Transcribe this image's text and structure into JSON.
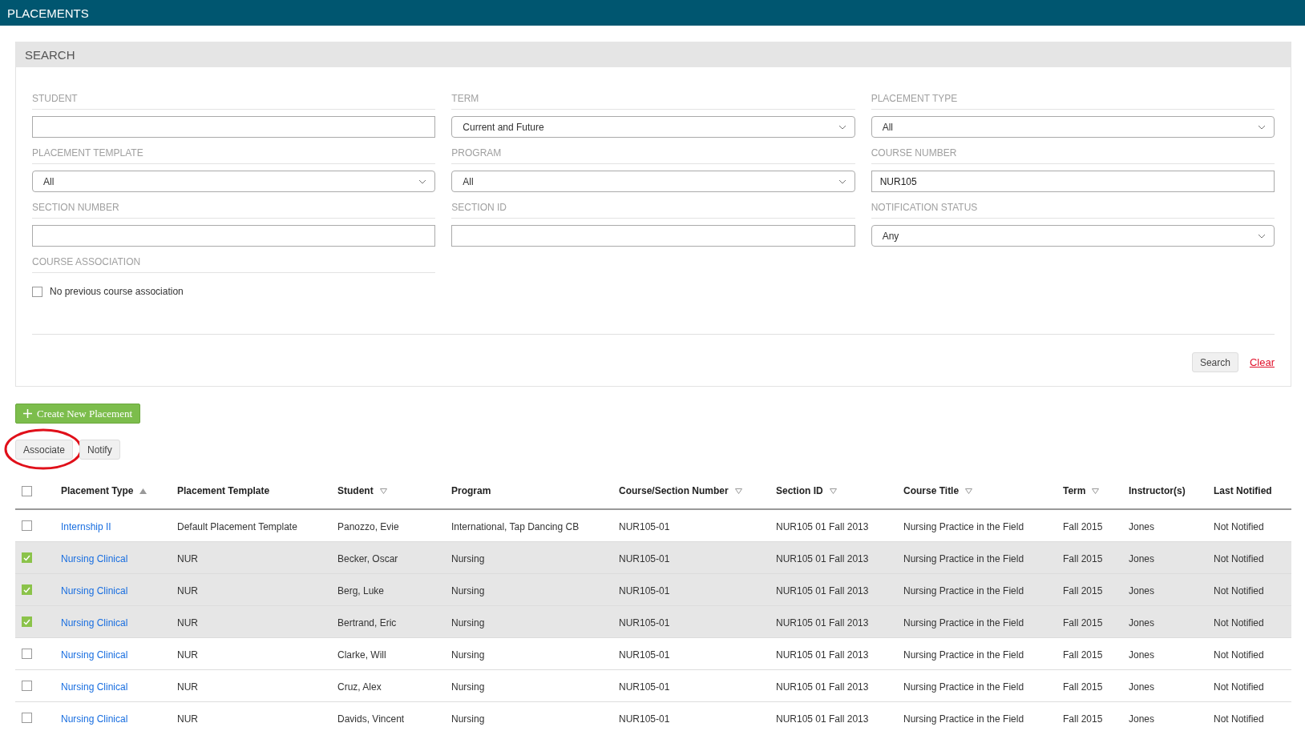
{
  "header": {
    "title": "PLACEMENTS"
  },
  "search": {
    "title": "SEARCH",
    "fields": [
      {
        "label": "STUDENT",
        "kind": "text"
      },
      {
        "label": "TERM",
        "kind": "select",
        "value": "Current and Future"
      },
      {
        "label": "PLACEMENT TYPE",
        "kind": "select",
        "value": "All"
      },
      {
        "label": "PLACEMENT TEMPLATE",
        "kind": "select",
        "value": "All"
      },
      {
        "label": "PROGRAM",
        "kind": "select",
        "value": "All"
      },
      {
        "label": "COURSE NUMBER",
        "kind": "text",
        "value": "NUR105"
      },
      {
        "label": "SECTION NUMBER",
        "kind": "text"
      },
      {
        "label": "SECTION ID",
        "kind": "text"
      },
      {
        "label": "NOTIFICATION STATUS",
        "kind": "select",
        "value": "Any"
      }
    ],
    "association": {
      "label": "COURSE ASSOCIATION",
      "option": "No previous course association",
      "checked": false
    },
    "buttons": {
      "search": "Search",
      "clear": "Clear"
    }
  },
  "create_button": "Create New Placement",
  "actions": [
    {
      "label": "Associate",
      "highlighted": true
    },
    {
      "label": "Notify",
      "highlighted": false
    }
  ],
  "table": {
    "select_all": false,
    "columns": [
      {
        "label": "Placement Type",
        "kind": "link",
        "sortable": true,
        "sorted": true
      },
      {
        "label": "Placement Template",
        "kind": "text"
      },
      {
        "label": "Student",
        "kind": "text",
        "sortable": true,
        "sorted": false
      },
      {
        "label": "Program",
        "kind": "text"
      },
      {
        "label": "Course/Section Number",
        "kind": "text",
        "sortable": true,
        "sorted": false
      },
      {
        "label": "Section ID",
        "kind": "text",
        "sortable": true,
        "sorted": false
      },
      {
        "label": "Course Title",
        "kind": "text",
        "sortable": true,
        "sorted": false
      },
      {
        "label": "Term",
        "kind": "text",
        "sortable": true,
        "sorted": false
      },
      {
        "label": "Instructor(s)",
        "kind": "text"
      },
      {
        "label": "Last Notified",
        "kind": "text"
      }
    ],
    "rows": [
      {
        "selected": false,
        "cells": [
          "Internship II",
          "Default Placement Template",
          "Panozzo, Evie",
          "International, Tap Dancing CB",
          "NUR105-01",
          "NUR105 01 Fall 2013",
          "Nursing Practice in the Field",
          "Fall 2015",
          "Jones",
          "Not Notified"
        ]
      },
      {
        "selected": true,
        "cells": [
          "Nursing Clinical",
          "NUR",
          "Becker, Oscar",
          "Nursing",
          "NUR105-01",
          "NUR105 01 Fall 2013",
          "Nursing Practice in the Field",
          "Fall 2015",
          "Jones",
          "Not Notified"
        ]
      },
      {
        "selected": true,
        "cells": [
          "Nursing Clinical",
          "NUR",
          "Berg, Luke",
          "Nursing",
          "NUR105-01",
          "NUR105 01 Fall 2013",
          "Nursing Practice in the Field",
          "Fall 2015",
          "Jones",
          "Not Notified"
        ]
      },
      {
        "selected": true,
        "cells": [
          "Nursing Clinical",
          "NUR",
          "Bertrand, Eric",
          "Nursing",
          "NUR105-01",
          "NUR105 01 Fall 2013",
          "Nursing Practice in the Field",
          "Fall 2015",
          "Jones",
          "Not Notified"
        ]
      },
      {
        "selected": false,
        "cells": [
          "Nursing Clinical",
          "NUR",
          "Clarke, Will",
          "Nursing",
          "NUR105-01",
          "NUR105 01 Fall 2013",
          "Nursing Practice in the Field",
          "Fall 2015",
          "Jones",
          "Not Notified"
        ]
      },
      {
        "selected": false,
        "cells": [
          "Nursing Clinical",
          "NUR",
          "Cruz, Alex",
          "Nursing",
          "NUR105-01",
          "NUR105 01 Fall 2013",
          "Nursing Practice in the Field",
          "Fall 2015",
          "Jones",
          "Not Notified"
        ]
      },
      {
        "selected": false,
        "cells": [
          "Nursing Clinical",
          "NUR",
          "Davids, Vincent",
          "Nursing",
          "NUR105-01",
          "NUR105 01 Fall 2013",
          "Nursing Practice in the Field",
          "Fall 2015",
          "Jones",
          "Not Notified"
        ]
      }
    ]
  }
}
